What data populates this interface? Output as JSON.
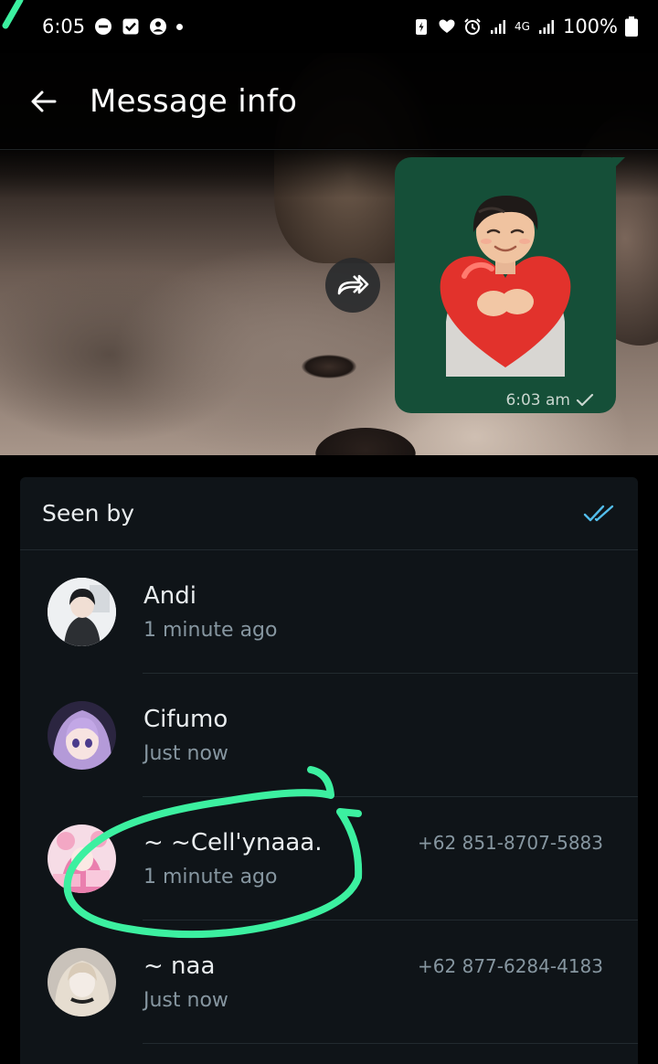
{
  "status_bar": {
    "time": "6:05",
    "network": "4G",
    "battery": "100%"
  },
  "app_bar": {
    "title": "Message info",
    "back_icon": "arrow-left-icon"
  },
  "message": {
    "time": "6:03 am",
    "status_icon": "single-check-icon",
    "forward_icon": "forward-icon"
  },
  "seen_by": {
    "title": "Seen by",
    "status_icon": "double-check-icon",
    "accent_color": "#53bdeb",
    "contacts": [
      {
        "name": "Andi",
        "time": "1 minute ago",
        "phone": ""
      },
      {
        "name": "Cifumo",
        "time": "Just now",
        "phone": ""
      },
      {
        "name": "~ ~Cell'ynaaa.",
        "time": "1 minute ago",
        "phone": "+62 851-8707-5883"
      },
      {
        "name": "~ naa",
        "time": "Just now",
        "phone": "+62 877-6284-4183"
      }
    ]
  },
  "colors": {
    "bubble": "#154f38",
    "annotation": "#3cf0a0",
    "card": "#0f1418"
  }
}
